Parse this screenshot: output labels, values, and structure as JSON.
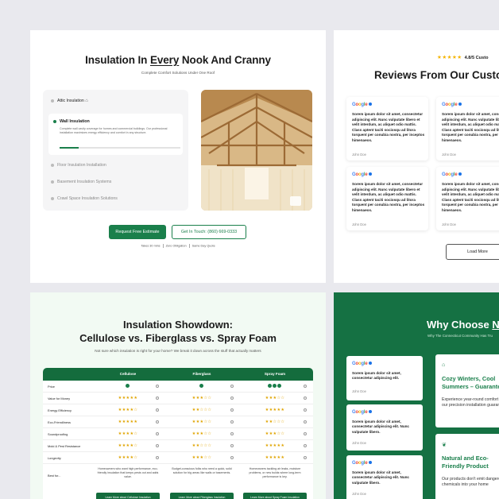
{
  "insulation": {
    "title_pre": "Insulation In ",
    "title_em": "Every",
    "title_post": " Nook And Cranny",
    "subtitle": "Complete Comfort Solutions Under One Roof",
    "items": [
      {
        "label": "Attic Insulation"
      },
      {
        "label": "Wall Insulation",
        "description": "Complete wall cavity coverage for homes and commercial buildings. Our professional installation maximizes energy efficiency and comfort in any structure.",
        "progress": 0.16
      },
      {
        "label": "Floor Insulation Installation"
      },
      {
        "label": "Basement Insulation Systems"
      },
      {
        "label": "Crawl Space Insulation Solutions"
      }
    ],
    "cta_primary": "Request Free Estimate",
    "cta_secondary": "Get In Touch: (860) 669-0333",
    "fine": [
      "Takes 30 mins",
      "Zero Obligation",
      "Same Day Quote"
    ]
  },
  "reviews": {
    "rating_stars": "★★★★★",
    "rating_text": "4.8/5 Custo",
    "title": "Reviews From Our Custom",
    "google_label": [
      "G",
      "o",
      "o",
      "g",
      "l",
      "e"
    ],
    "cards": [
      {
        "text": "Sorem ipsum dolor sit amet, consectetur adipiscing elit. Nunc vulputate libero et velit interdum, ac aliquet odio mattis. Class aptent taciti sociosqu ad litora torquent per conubia nostra, per inceptos himenaeos.",
        "author": "John Doe"
      },
      {
        "text": "Sorem ipsum dolor sit amet, consectetur adipiscing elit. Nunc vulputate libero et velit interdum, ac aliquet odio mattis. Class aptent taciti sociosqu ad litora torquent per conubia nostra, per inceptos himenaeos.",
        "author": "John Doe"
      },
      {
        "text": "Sorem ipsum dolor sit amet, consectetur adipiscing elit. Nunc vulputate libero et velit interdum, ac aliquet odio mattis. Class aptent taciti sociosqu ad litora torquent per conubia nostra, per inceptos himenaeos.",
        "author": "John Doe"
      },
      {
        "text": "Sorem ipsum dolor sit amet, consectetur adipiscing elit. Nunc vulputate libero et velit interdum, ac aliquet odio mattis. Class aptent taciti sociosqu ad litora torquent per conubia nostra, per inceptos himenaeos.",
        "author": "John Doe"
      }
    ],
    "load_more": "Load More"
  },
  "showdown": {
    "title_line1": "Insulation Showdown:",
    "title_line2": "Cellulose vs. Fiberglass vs. Spray Foam",
    "subtitle": "Not sure which insulation is right for your home? We break it down across the stuff that actually matters",
    "columns": [
      "Cellulose",
      "Fiberglass",
      "Spray Foam"
    ],
    "price_label": "Price",
    "price_levels": [
      1,
      1,
      3
    ],
    "rows": [
      {
        "label": "Value for Money",
        "stars": [
          "★★★★★",
          "★★★☆☆",
          "★★★☆☆"
        ]
      },
      {
        "label": "Energy Efficiency",
        "stars": [
          "★★★★☆",
          "★★☆☆☆",
          "★★★★★"
        ]
      },
      {
        "label": "Eco-Friendliness",
        "stars": [
          "★★★★★",
          "★★★☆☆",
          "★★☆☆☆"
        ]
      },
      {
        "label": "Soundproofing",
        "stars": [
          "★★★★☆",
          "★★★☆☆",
          "★★★☆☆"
        ]
      },
      {
        "label": "Mold & Pest Resistance",
        "stars": [
          "★★★★☆",
          "★★☆☆☆",
          "★★★★★"
        ]
      },
      {
        "label": "Longevity",
        "stars": [
          "★★★★☆",
          "★★★☆☆",
          "★★★★★"
        ]
      }
    ],
    "best_for_label": "Best for...",
    "best_for": [
      "Homeowners who want high performance, eco-friendly insulation that keeps pests out and adds value.",
      "Budget-conscious folks who need a quick, solid solution for big areas like walls or basements.",
      "Homeowners tackling air leaks, moisture problems, or new builds where long-term performance is key."
    ],
    "learn_more": [
      "Learn More about Cellulose Insulation",
      "Learn More about Fiberglass Insulation",
      "Learn More about Spray Foam Insulation"
    ]
  },
  "why": {
    "title_pre": "Why Choose ",
    "title_em": "N",
    "subtitle": "Why The Connecticut Community Has Tru",
    "reviews": [
      {
        "text": "Sorem ipsum dolor sit amet, consectetur adipiscing elit.",
        "author": "John Doe"
      },
      {
        "text": "Sorem ipsum dolor sit amet, consectetur adipiscing elit. Nunc vulputate libero.",
        "author": "John Doe"
      },
      {
        "text": "Sorem ipsum dolor sit amet, consectetur adipiscing elit. Nunc vulputate libero.",
        "author": "John Doe"
      }
    ],
    "features": [
      {
        "title": "Cozy Winters, Cool Summers – Guarante",
        "desc": "Experience year-round comfort with our precision installation guarantee"
      },
      {
        "title": "Natural and Eco-Friendly Product",
        "desc": "Our products don't emit dangerous chemicals into your home"
      }
    ]
  },
  "colors": {
    "brand_green": "#1a7f4b",
    "dark_green": "#157143",
    "star": "#f5b400"
  }
}
